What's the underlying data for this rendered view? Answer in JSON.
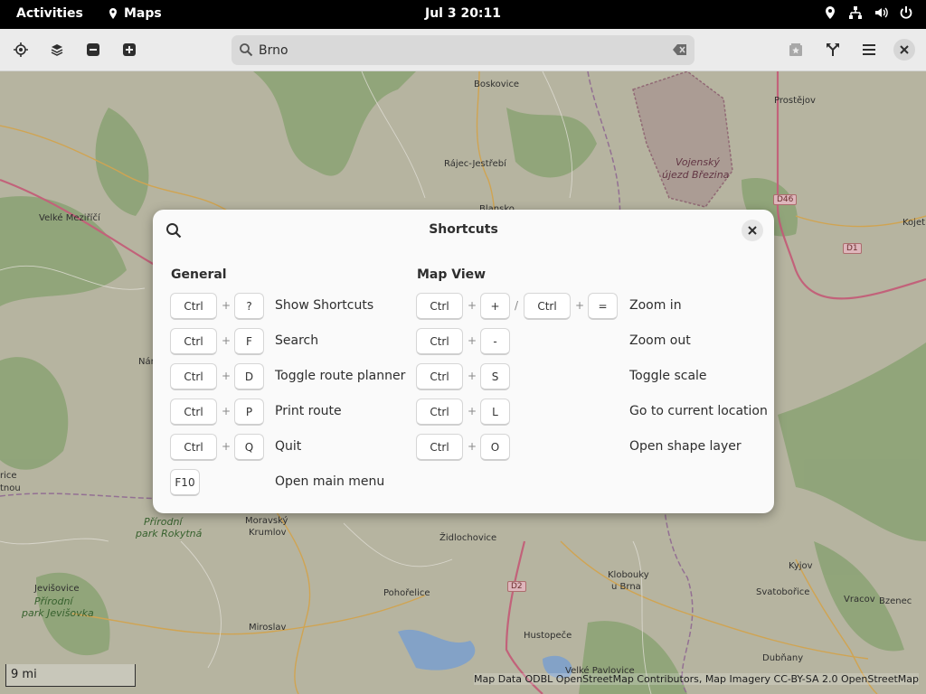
{
  "topbar": {
    "activities": "Activities",
    "app_name": "Maps",
    "clock": "Jul 3  20:11"
  },
  "headerbar": {
    "search_value": "Brno"
  },
  "map": {
    "places": [
      {
        "name": "Boskovice"
      },
      {
        "name": "Prostějov"
      },
      {
        "name": "Rájec-Jestřebí"
      },
      {
        "name": "Velké Meziříčí"
      },
      {
        "name": "Blansko"
      },
      {
        "name": "Kojet"
      },
      {
        "name": "Nám"
      },
      {
        "name": "rice"
      },
      {
        "name": "tnou"
      },
      {
        "name": "Moravský"
      },
      {
        "name": "Krumlov"
      },
      {
        "name": "Židlochovice"
      },
      {
        "name": "Klobouky"
      },
      {
        "name": "u Brna"
      },
      {
        "name": "Kyjov"
      },
      {
        "name": "Jevišovice"
      },
      {
        "name": "Pohořelice"
      },
      {
        "name": "Svatobořice"
      },
      {
        "name": "Vracov"
      },
      {
        "name": "Bzenec"
      },
      {
        "name": "Miroslav"
      },
      {
        "name": "Hustopeče"
      },
      {
        "name": "Dubňany"
      },
      {
        "name": "Velké Pavlovice"
      }
    ],
    "parks": [
      {
        "line1": "Přírodní",
        "line2": "park Rokytná"
      },
      {
        "line1": "Přírodní",
        "line2": "park Jevišovka"
      }
    ],
    "zone": {
      "line1": "Vojenský",
      "line2": "újezd Březina"
    },
    "shields": [
      "D46",
      "D1",
      "D2"
    ],
    "scale": "9 mi",
    "attribution": "Map Data ODBL OpenStreetMap Contributors, Map Imagery CC-BY-SA 2.0 OpenStreetMap"
  },
  "dialog": {
    "title": "Shortcuts",
    "general": {
      "title": "General",
      "rows": [
        {
          "mod": "Ctrl",
          "plus": "+",
          "key": "?",
          "label": "Show Shortcuts"
        },
        {
          "mod": "Ctrl",
          "plus": "+",
          "key": "F",
          "label": "Search"
        },
        {
          "mod": "Ctrl",
          "plus": "+",
          "key": "D",
          "label": "Toggle route planner"
        },
        {
          "mod": "Ctrl",
          "plus": "+",
          "key": "P",
          "label": "Print route"
        },
        {
          "mod": "Ctrl",
          "plus": "+",
          "key": "Q",
          "label": "Quit"
        },
        {
          "key": "F10",
          "label": "Open main menu"
        }
      ]
    },
    "mapview": {
      "title": "Map View",
      "zoom_in": {
        "mod": "Ctrl",
        "plus": "+",
        "key": "+",
        "slash": "/",
        "mod2": "Ctrl",
        "plus2": "+",
        "key2": "=",
        "label": "Zoom in"
      },
      "rows": [
        {
          "mod": "Ctrl",
          "plus": "+",
          "key": "-",
          "label": "Zoom out"
        },
        {
          "mod": "Ctrl",
          "plus": "+",
          "key": "S",
          "label": "Toggle scale"
        },
        {
          "mod": "Ctrl",
          "plus": "+",
          "key": "L",
          "label": "Go to current location"
        },
        {
          "mod": "Ctrl",
          "plus": "+",
          "key": "O",
          "label": "Open shape layer"
        }
      ]
    }
  },
  "colors": {
    "map_bg": "#c6c4ae",
    "forest": "#97b07e",
    "road_major": "#d36b85",
    "road_minor": "#e2b25a",
    "water": "#8fb0d8",
    "border": "#a07aa0"
  }
}
